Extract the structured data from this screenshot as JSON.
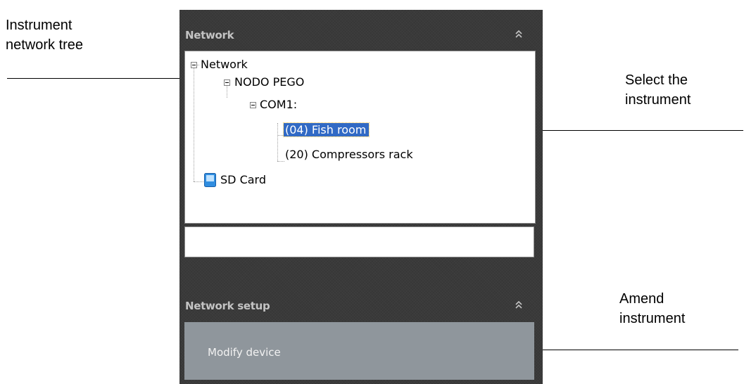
{
  "annotations": {
    "tree_label": [
      "Instrument",
      "network tree"
    ],
    "select_label": [
      "Select the",
      "instrument"
    ],
    "amend_label": [
      "Amend",
      "instrument"
    ]
  },
  "network_panel": {
    "title": "Network",
    "tree": {
      "root": "Network",
      "node": "NODO PEGO",
      "port": "COM1:",
      "device_selected": "(04) Fish room",
      "device_other": "(20) Compressors rack",
      "sd_card": "SD Card"
    },
    "search_value": ""
  },
  "setup_panel": {
    "title": "Network setup",
    "modify_button": "Modify device"
  },
  "colors": {
    "panel_bg": "#3a3a3a",
    "header_text": "#c3c3c3",
    "selection": "#316ac5",
    "button_bg": "#8f969c"
  }
}
